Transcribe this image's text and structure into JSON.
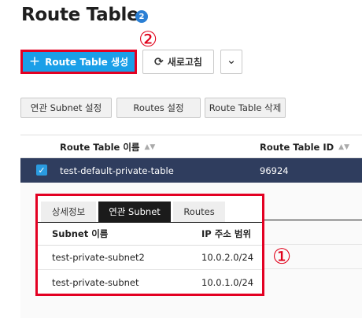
{
  "page": {
    "title": "Route Table",
    "count": "2"
  },
  "annotations": {
    "marker_one": "①",
    "marker_two": "②"
  },
  "header_actions": {
    "create_plus": "+",
    "create_label": "Route Table 생성",
    "refresh_icon": "⟳",
    "refresh_label": "새로고침",
    "more_icon": "⌄"
  },
  "toolbar": {
    "associated_subnet": "연관 Subnet 설정",
    "routes_settings": "Routes 설정",
    "delete_route_table": "Route Table 삭제"
  },
  "table": {
    "columns": {
      "name": "Route Table 이름",
      "id": "Route Table ID",
      "sort_icon": "▲▼"
    },
    "rows": [
      {
        "checked": "✓",
        "name": "test-default-private-table",
        "id": "96924"
      }
    ]
  },
  "detail": {
    "tabs": {
      "detail": "상세정보",
      "associated_subnet": "연관 Subnet",
      "routes": "Routes"
    },
    "active_tab": "연관 Subnet",
    "subnet_table": {
      "columns": {
        "name": "Subnet 이름",
        "ip_range": "IP 주소 범위"
      },
      "rows": [
        {
          "name": "test-private-subnet2",
          "ip": "10.0.2.0/24"
        },
        {
          "name": "test-private-subnet",
          "ip": "10.0.1.0/24"
        }
      ]
    }
  },
  "colors": {
    "primary": "#1a9fe8",
    "highlight_red": "#e30022",
    "selected_row": "#2f3d5e",
    "badge": "#2a7fd4"
  }
}
